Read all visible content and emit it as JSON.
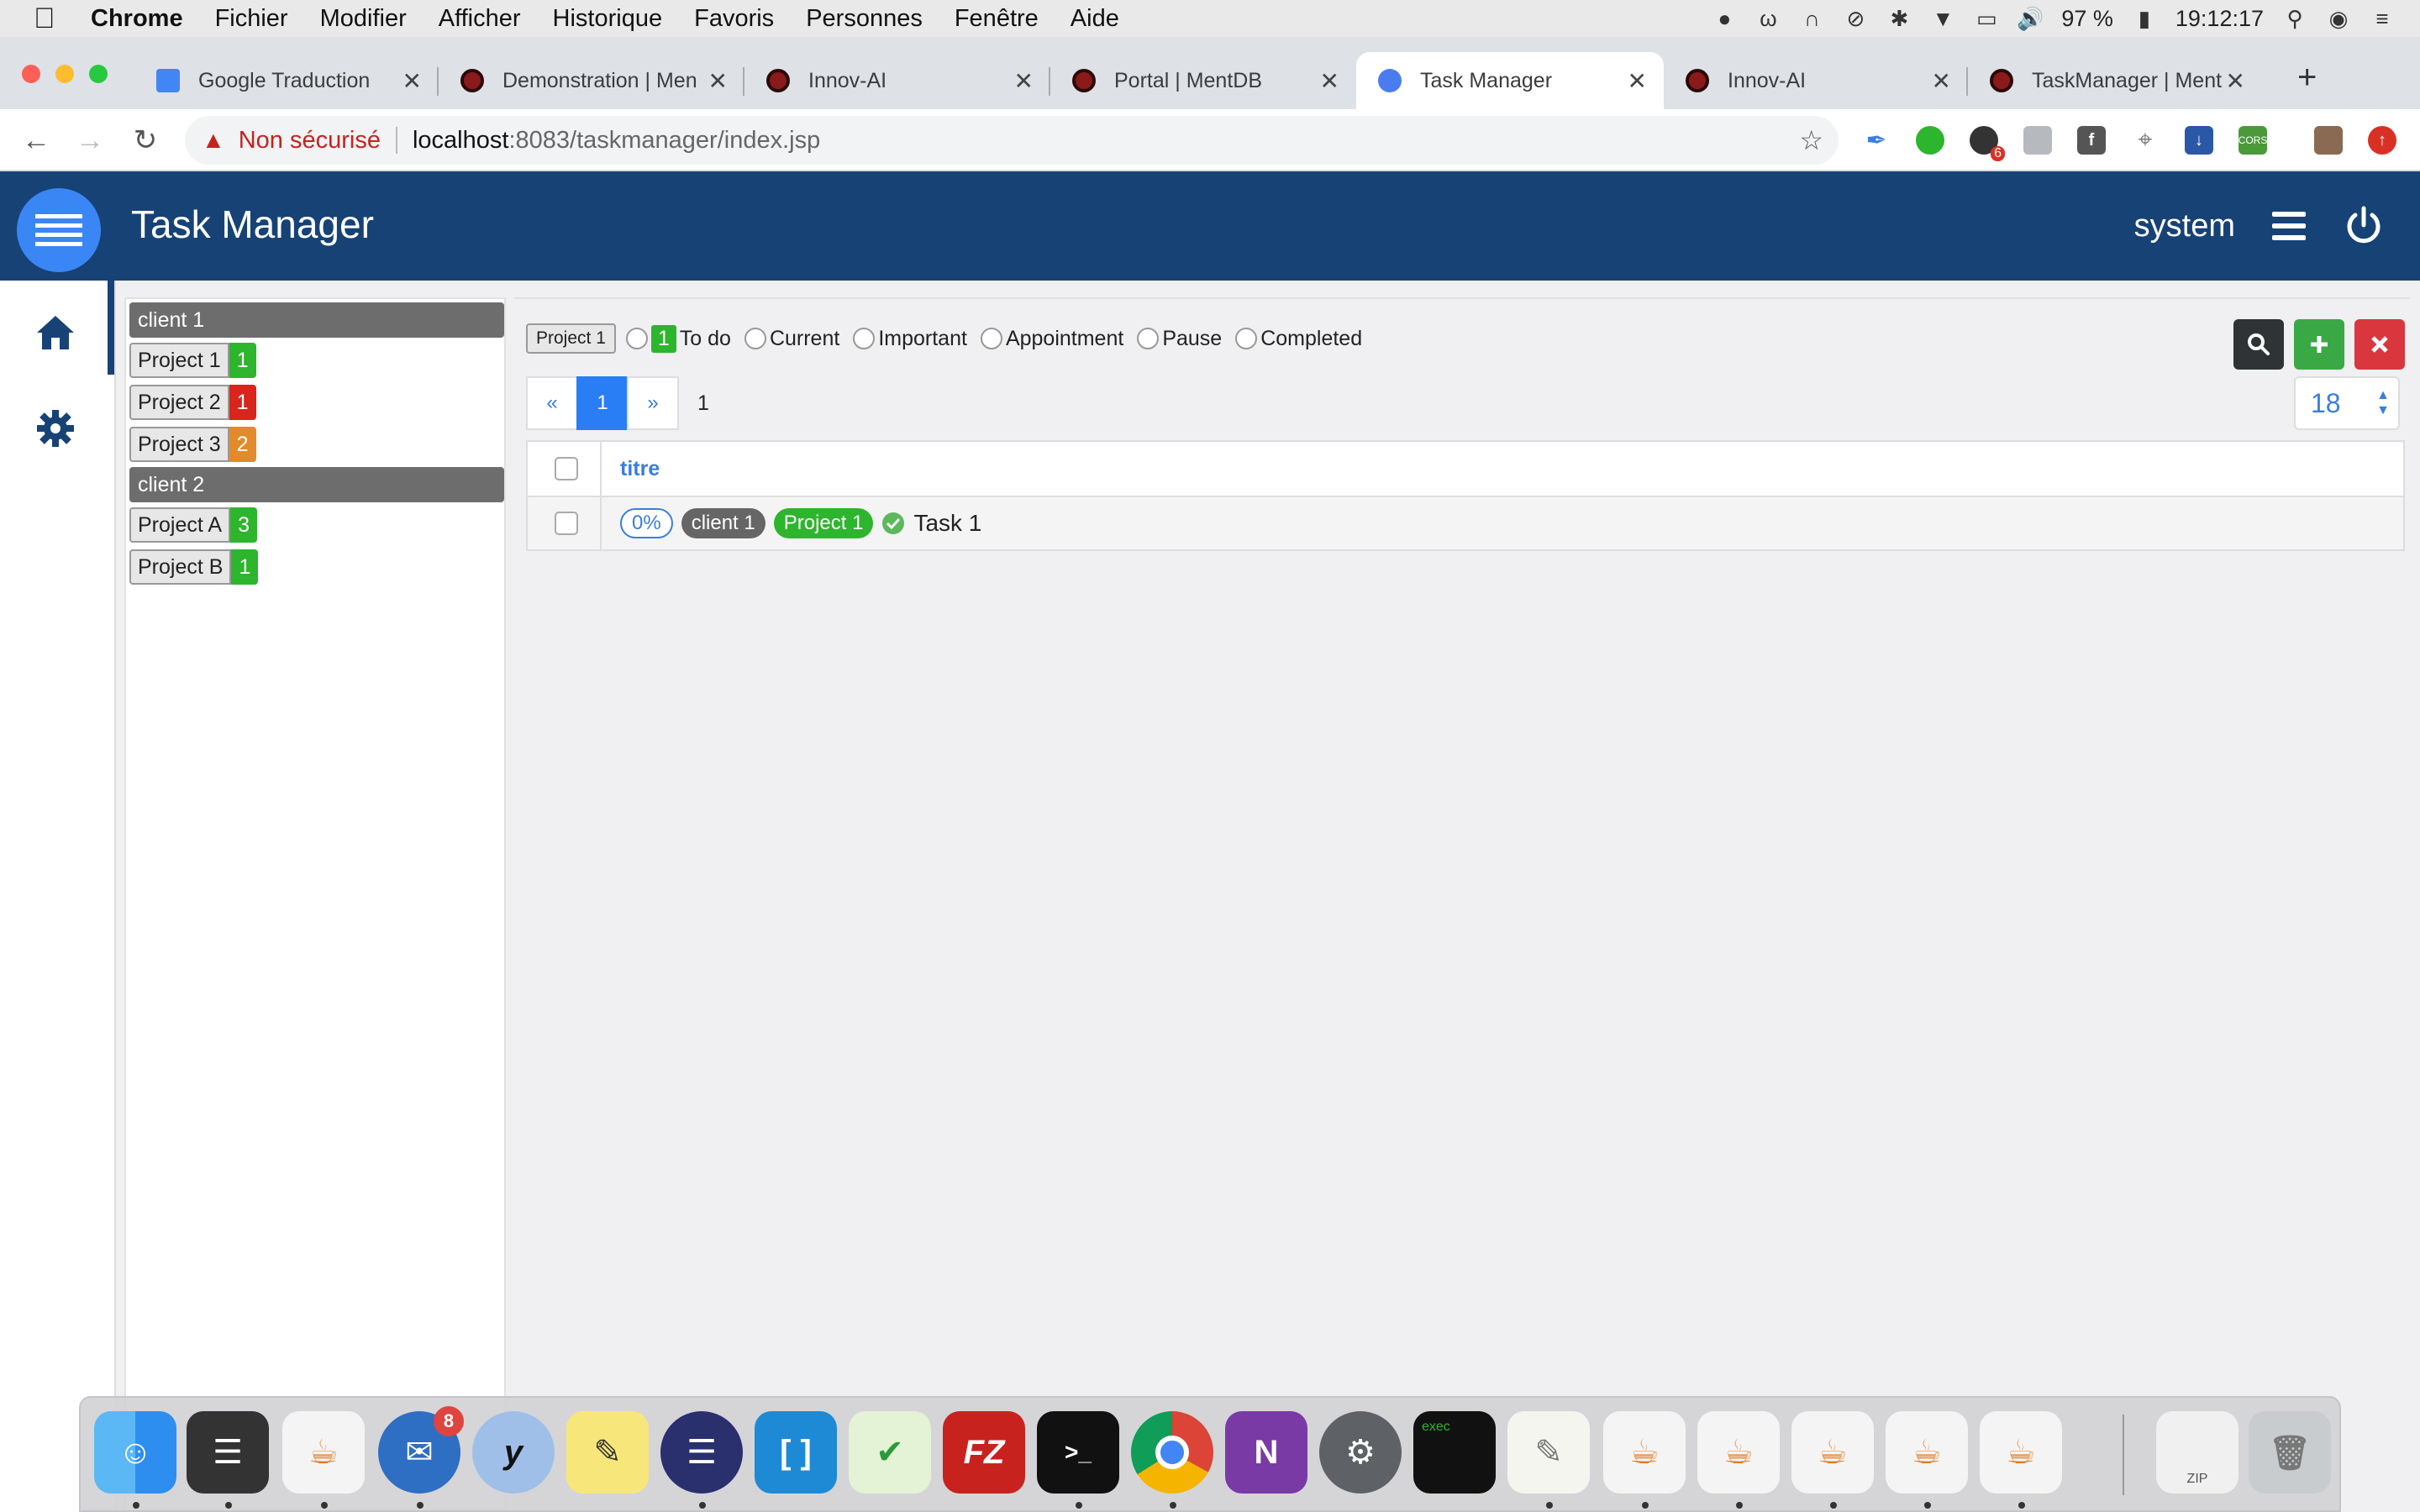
{
  "menubar": {
    "app": "Chrome",
    "items": [
      "Fichier",
      "Modifier",
      "Afficher",
      "Historique",
      "Favoris",
      "Personnes",
      "Fenêtre",
      "Aide"
    ],
    "battery": "97 %",
    "time": "19:12:17"
  },
  "tabs": [
    {
      "title": "Google Traduction",
      "color": "#4285f4"
    },
    {
      "title": "Demonstration | Men",
      "color": "#8b1a1a"
    },
    {
      "title": "Innov-AI",
      "color": "#8b1a1a"
    },
    {
      "title": "Portal | MentDB",
      "color": "#8b1a1a"
    },
    {
      "title": "Task Manager",
      "color": "#4a7cf0"
    },
    {
      "title": "Innov-AI",
      "color": "#8b1a1a"
    },
    {
      "title": "TaskManager | Ment",
      "color": "#8b1a1a"
    }
  ],
  "new_tab": "+",
  "address": {
    "security": "Non sécurisé",
    "host": "localhost",
    "path": ":8083/taskmanager/index.jsp",
    "ext_badge": "6"
  },
  "header": {
    "title": "Task Manager",
    "user": "system",
    "bg_color": "#174276"
  },
  "clients": [
    {
      "name": "client 1",
      "projects": [
        {
          "name": "Project 1",
          "count": "1",
          "color": "#2db52d"
        },
        {
          "name": "Project 2",
          "count": "1",
          "color": "#d9261c"
        },
        {
          "name": "Project 3",
          "count": "2",
          "color": "#e38b2b"
        }
      ]
    },
    {
      "name": "client 2",
      "projects": [
        {
          "name": "Project A",
          "count": "3",
          "color": "#2db52d"
        },
        {
          "name": "Project B",
          "count": "1",
          "color": "#2db52d"
        }
      ]
    }
  ],
  "filters": {
    "selected_project": "Project 1",
    "todo_count": "1",
    "todo": "To do",
    "current": "Current",
    "important": "Important",
    "appointment": "Appointment",
    "pause": "Pause",
    "completed": "Completed"
  },
  "pager": {
    "prev": "«",
    "current": "1",
    "next": "»",
    "total": "1",
    "page_size": "18"
  },
  "table": {
    "header": "titre",
    "rows": [
      {
        "progress": "0%",
        "client": "client 1",
        "project": "Project 1",
        "title": "Task 1"
      }
    ]
  },
  "dock": {
    "thunderbird_badge": "8",
    "exec_label": "exec",
    "zip_label": "ZIP"
  }
}
